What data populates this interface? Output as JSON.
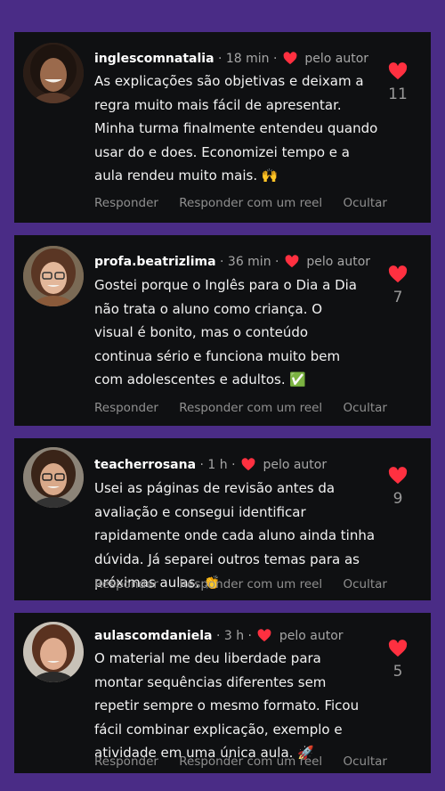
{
  "comments": [
    {
      "username": "inglescomnatalia",
      "time": "18 min",
      "author_badge": "pelo autor",
      "text": "As explicações são objetivas e deixam a regra muito mais fácil de apresentar. Minha turma finalmente entendeu quando usar do e does. Economizei tempo e a aula rendeu muito mais. 🙌",
      "likes": "11",
      "actions": [
        "Responder",
        "Responder com um reel",
        "Ocultar"
      ],
      "avatar_icon": "woman-avatar-icon"
    },
    {
      "username": "profa.beatrizlima",
      "time": "36 min",
      "author_badge": "pelo autor",
      "text": "Gostei porque o Inglês para o Dia a Dia não trata o aluno como criança. O visual é bonito, mas o conteúdo continua sério e funciona muito bem com adolescentes e adultos. ✅",
      "likes": "7",
      "actions": [
        "Responder",
        "Responder com um reel",
        "Ocultar"
      ],
      "avatar_icon": "woman-glasses-avatar-icon"
    },
    {
      "username": "teacherrosana",
      "time": "1 h",
      "author_badge": "pelo autor",
      "text": "Usei as páginas de revisão antes da avaliação e consegui identificar rapidamente onde cada aluno ainda tinha dúvida. Já separei outros temas para as próximas aulas. 👏",
      "likes": "9",
      "actions": [
        "Responder",
        "Responder com um reel",
        "Ocultar"
      ],
      "avatar_icon": "woman-glasses-avatar-icon"
    },
    {
      "username": "aulascomdaniela",
      "time": "3 h",
      "author_badge": "pelo autor",
      "text": "O material me deu liberdade para montar sequências diferentes sem repetir sempre o mesmo formato. Ficou fácil combinar explicação, exemplo e atividade em uma única aula. 🚀",
      "likes": "5",
      "actions": [
        "Responder",
        "Responder com um reel",
        "Ocultar"
      ],
      "avatar_icon": "woman-avatar-icon"
    }
  ],
  "colors": {
    "background": "#4a2c86",
    "card": "#0f1012",
    "heart": "#ff3040",
    "muted_text": "#8f8f8f"
  }
}
